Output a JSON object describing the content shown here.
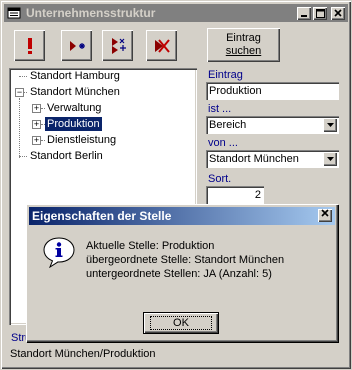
{
  "window": {
    "title": "Unternehmensstruktur"
  },
  "toolbar": {
    "search_line1": "Eintrag",
    "search_line2": "suchen"
  },
  "tree": {
    "items": [
      {
        "label": "Standort Hamburg"
      },
      {
        "label": "Standort München"
      },
      {
        "label": "Verwaltung"
      },
      {
        "label": "Produktion"
      },
      {
        "label": "Dienstleistung"
      },
      {
        "label": "Standort Berlin"
      }
    ]
  },
  "panel": {
    "entry_label": "Eintrag",
    "entry_value": "Produktion",
    "is_label": "ist ...",
    "is_value": "Bereich",
    "of_label": "von ...",
    "of_value": "Standort München",
    "sort_label": "Sort.",
    "sort_value": "2"
  },
  "hidden_label_partial": "Stru",
  "status": {
    "path": "Standort München/Produktion"
  },
  "dialog": {
    "title": "Eigenschaften der Stelle",
    "lines": [
      "Aktuelle Stelle: Produktion",
      "übergeordnete Stelle: Standort München",
      "untergeordnete Stellen: JA (Anzahl: 5)"
    ],
    "ok_label": "OK"
  }
}
